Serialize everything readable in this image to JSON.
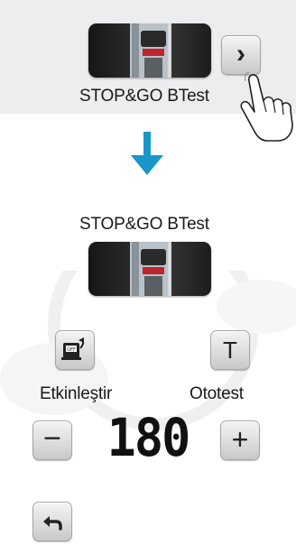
{
  "top_section": {
    "device_label": "STOP&GO BTest",
    "next_button_glyph": "›"
  },
  "main_section": {
    "device_label": "STOP&GO BTest",
    "enable_label": "Etkinleştir",
    "autotest_label": "Ototest",
    "autotest_button_glyph": "T",
    "minus_glyph": "−",
    "plus_glyph": "+",
    "counter_value": "180"
  },
  "icons": {
    "next": "chevron-right-icon",
    "pointer": "hand-pointer-icon",
    "step": "arrow-down-icon",
    "enable": "breaker-reset-icon",
    "back": "back-arrow-icon"
  },
  "colors": {
    "arrow": "#1a96c8",
    "panel": "#ecedef"
  }
}
